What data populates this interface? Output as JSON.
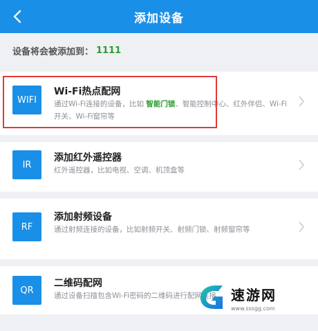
{
  "header": {
    "title": "添加设备"
  },
  "target": {
    "label": "设备将会被添加到：",
    "name": "1111"
  },
  "items": [
    {
      "badge": "WIFI",
      "title": "Wi-Fi热点配网",
      "desc_pre": "通过Wi-Fi连接的设备，比如 ",
      "desc_hl": "智能门锁",
      "desc_post": "、智能控制中心、红外伴侣、Wi-Fi开关、Wi-Fi窗帘等"
    },
    {
      "badge": "IR",
      "title": "添加红外遥控器",
      "desc": "红外遥控器，比如电视、空调、机顶盒等"
    },
    {
      "badge": "RF",
      "title": "添加射频设备",
      "desc": "通过射频连接的设备，比如射频开关、射频门锁、射频窗帘等"
    },
    {
      "badge": "QR",
      "title": "二维码配网",
      "desc": "通过设备扫描包含Wi-Fi密码的二维码进行配网连接"
    }
  ],
  "watermark": {
    "title": "速游网",
    "url": "www.sssgg.com"
  },
  "colors": {
    "primary": "#1a8fe8",
    "highlight": "#2f9a2f",
    "annotation": "#e03a3a"
  }
}
